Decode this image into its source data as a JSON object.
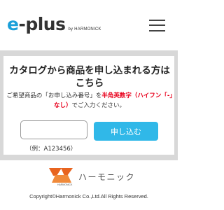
{
  "header": {
    "logo_e": "e",
    "logo_rest": "-plus",
    "logo_by": "by HARMONICK"
  },
  "form": {
    "title": "カタログから商品を申し込まれる方はこちら",
    "desc_1": "ご希望商品の「お申し込み番号」を",
    "desc_red": "半角英数字（ハイフン「-」なし）",
    "desc_2": "でご入力ください。",
    "input_value": "",
    "submit_label": "申し込む",
    "example": "（例：A123456）"
  },
  "footer": {
    "brand_name": "ハーモニック",
    "brand_sub": "HARMONICK",
    "copyright": "Copyright©Harmonick Co.,Ltd.All Rights Reserved."
  },
  "colors": {
    "brand_blue": "#1a9fd9",
    "button": "#30b8e8",
    "accent_red": "#e8001c",
    "brand_orange": "#e8641f"
  }
}
